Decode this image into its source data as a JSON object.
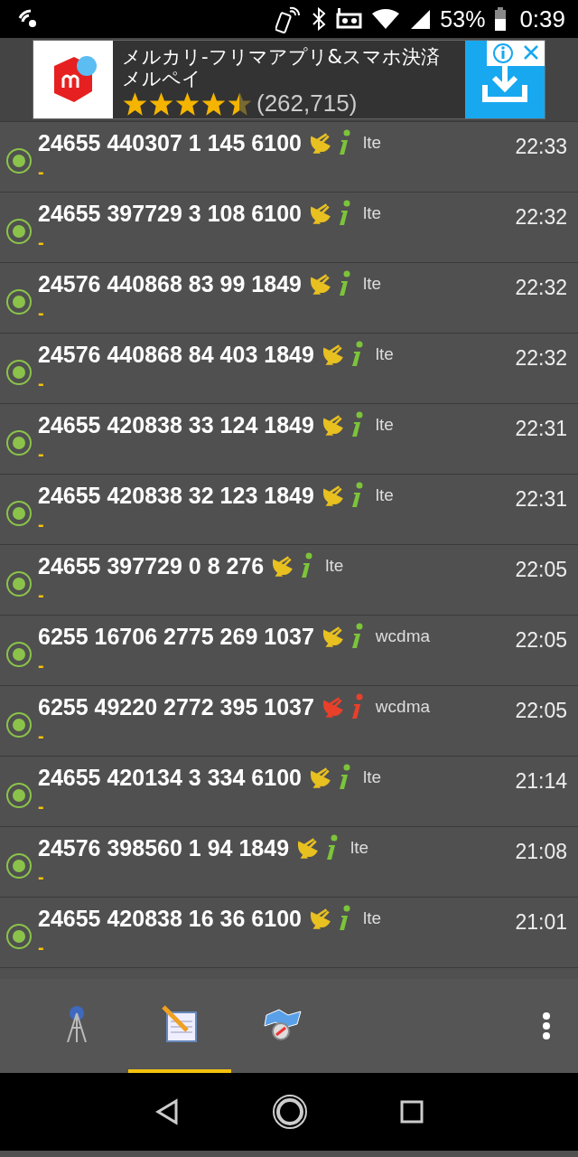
{
  "status_bar": {
    "battery": "53%",
    "time": "0:39"
  },
  "ad": {
    "title": "メルカリ-フリマアプリ&スマホ決済メルペイ",
    "stars": 4.5,
    "rating_count": "(262,715)"
  },
  "rows": [
    {
      "title": "24655 440307 1 145 6100",
      "network": "lte",
      "time": "22:33",
      "note": "-",
      "alert": false
    },
    {
      "title": "24655 397729 3 108 6100",
      "network": "lte",
      "time": "22:32",
      "note": "-",
      "alert": false
    },
    {
      "title": "24576 440868 83 99 1849",
      "network": "lte",
      "time": "22:32",
      "note": "-",
      "alert": false
    },
    {
      "title": "24576 440868 84 403 1849",
      "network": "lte",
      "time": "22:32",
      "note": "-",
      "alert": false
    },
    {
      "title": "24655 420838 33 124 1849",
      "network": "lte",
      "time": "22:31",
      "note": "-",
      "alert": false
    },
    {
      "title": "24655 420838 32 123 1849",
      "network": "lte",
      "time": "22:31",
      "note": "-",
      "alert": false
    },
    {
      "title": "24655 397729 0 8 276",
      "network": "lte",
      "time": "22:05",
      "note": "-",
      "alert": false
    },
    {
      "title": "6255 16706 2775 269 1037",
      "network": "wcdma",
      "time": "22:05",
      "note": "-",
      "alert": false
    },
    {
      "title": "6255 49220 2772 395 1037",
      "network": "wcdma",
      "time": "22:05",
      "note": "-",
      "alert": true
    },
    {
      "title": "24655 420134 3 334 6100",
      "network": "lte",
      "time": "21:14",
      "note": "-",
      "alert": false
    },
    {
      "title": "24576 398560 1 94 1849",
      "network": "lte",
      "time": "21:08",
      "note": "-",
      "alert": false
    },
    {
      "title": "24655 420838 16 36 6100",
      "network": "lte",
      "time": "21:01",
      "note": "-",
      "alert": false
    }
  ],
  "tabs": [
    {
      "kind": "tower",
      "selected": false
    },
    {
      "kind": "notepad",
      "selected": true
    },
    {
      "kind": "map",
      "selected": false
    }
  ]
}
